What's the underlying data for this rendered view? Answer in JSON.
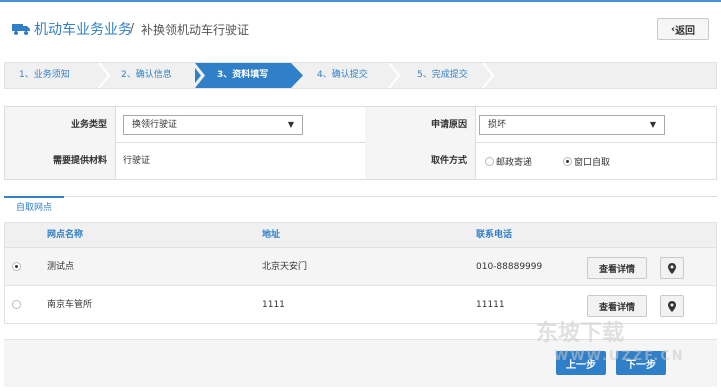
{
  "header": {
    "title": "机动车业务业务",
    "separator": "/",
    "subtitle": "补换领机动车行驶证",
    "back_label": "返回",
    "back_icon": "chevron-left-icon",
    "logo_icon": "truck-icon"
  },
  "steps": [
    {
      "label": "1、业务须知",
      "active": false
    },
    {
      "label": "2、确认信息",
      "active": false
    },
    {
      "label": "3、资料填写",
      "active": true
    },
    {
      "label": "4、确认提交",
      "active": false
    },
    {
      "label": "5、完成提交",
      "active": false
    }
  ],
  "form": {
    "business_type_label": "业务类型",
    "business_type_value": "换领行驶证",
    "reason_label": "申请原因",
    "reason_value": "损坏",
    "materials_label": "需要提供材料",
    "materials_value": "行驶证",
    "pickup_label": "取件方式",
    "pickup_options": [
      {
        "label": "邮政寄递",
        "selected": false
      },
      {
        "label": "窗口自取",
        "selected": true
      }
    ]
  },
  "tab": {
    "label": "自取网点"
  },
  "table": {
    "columns": [
      "网点名称",
      "地址",
      "联系电话"
    ],
    "rows": [
      {
        "selected": true,
        "name": "测试点",
        "address": "北京天安门",
        "phone": "010-88889999",
        "detail_label": "查看详情"
      },
      {
        "selected": false,
        "name": "南京车管所",
        "address": "1111",
        "phone": "11111",
        "detail_label": "查看详情"
      }
    ]
  },
  "footer": {
    "prev_label": "上一步",
    "next_label": "下一步"
  },
  "watermark": {
    "top": "东坡下载",
    "bottom": "WWW.UZZF.CN"
  },
  "colors": {
    "accent": "#2f7fc9",
    "step_bg": "#f0f0f0",
    "label_bg": "#f5f5f5"
  }
}
